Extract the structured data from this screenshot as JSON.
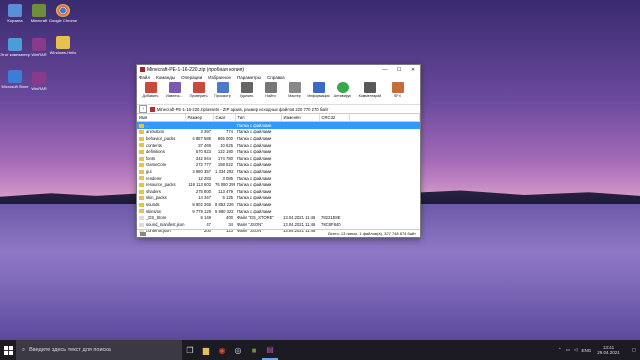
{
  "desktop": {
    "icons": [
      {
        "label": "Корзина",
        "color": "#5a8fd8"
      },
      {
        "label": "Minecraft",
        "color": "#6b8f3a"
      },
      {
        "label": "Google Chrome",
        "color": "#e0e0e0"
      },
      {
        "label": "Этот компьютер",
        "color": "#4a9ed8"
      },
      {
        "label": "WinRAR",
        "color": "#8a3a8a"
      },
      {
        "label": "Windows-Hello",
        "color": "#5a9ad8"
      },
      {
        "label": "Microsoft Store",
        "color": "#3a7ed8"
      },
      {
        "label": "WinRAR",
        "color": "#8a3a8a"
      }
    ]
  },
  "window": {
    "title": "Minecraft-PE-1-16-220.zip (пробная копия)",
    "menu": [
      "Файл",
      "Команды",
      "Операции",
      "Избранное",
      "Параметры",
      "Справка"
    ],
    "toolbar": [
      {
        "label": "Добавить",
        "icon": "add-archive-icon",
        "color": "#c84a3a"
      },
      {
        "label": "Извлечь...",
        "icon": "extract-icon",
        "color": "#7a5ab0"
      },
      {
        "label": "Проверить",
        "icon": "test-icon",
        "color": "#c84a3a"
      },
      {
        "label": "Просмотр",
        "icon": "view-icon",
        "color": "#4a7ac8"
      },
      {
        "label": "Удалить",
        "icon": "delete-icon",
        "color": "#666666"
      },
      {
        "label": "Найти",
        "icon": "find-icon",
        "color": "#777777"
      },
      {
        "label": "Мастер",
        "icon": "wizard-icon",
        "color": "#888888"
      },
      {
        "label": "Информация",
        "icon": "info-icon",
        "color": "#3a6ac8"
      },
      {
        "label": "Антивирус",
        "icon": "antivirus-icon",
        "color": "#3aa84a"
      },
      {
        "label": "Комментарий",
        "icon": "comment-icon",
        "color": "#5a5a5a"
      },
      {
        "label": "SFX",
        "icon": "sfx-icon",
        "color": "#c86a3a"
      }
    ],
    "path": "Minecraft-PE-1-16-220.zip\\assets - ZIP архив, размер исходных файлов 220 770 270 байт",
    "columns": [
      "Имя",
      "Размер",
      "Сжат",
      "Тип",
      "Изменён",
      "CRC32"
    ],
    "rows": [
      {
        "name": "..",
        "size": "",
        "packed": "",
        "type": "Папка с файлами",
        "modified": "",
        "crc": "",
        "selected": true
      },
      {
        "name": "animation",
        "size": "3 397",
        "packed": "774",
        "type": "Папка с файлами",
        "modified": "",
        "crc": "",
        "selected": false
      },
      {
        "name": "behavior_packs",
        "size": "4 887 589",
        "packed": "865 000",
        "type": "Папка с файлами",
        "modified": "",
        "crc": "",
        "selected": false
      },
      {
        "name": "contents",
        "size": "37 469",
        "packed": "10 625",
        "type": "Папка с файлами",
        "modified": "",
        "crc": "",
        "selected": false
      },
      {
        "name": "definitions",
        "size": "570 823",
        "packed": "122 180",
        "type": "Папка с файлами",
        "modified": "",
        "crc": "",
        "selected": false
      },
      {
        "name": "fonts",
        "size": "342 944",
        "packed": "174 780",
        "type": "Папка с файлами",
        "modified": "",
        "crc": "",
        "selected": false
      },
      {
        "name": "GameCore",
        "size": "272 777",
        "packed": "158 522",
        "type": "Папка с файлами",
        "modified": "",
        "crc": "",
        "selected": false
      },
      {
        "name": "gui",
        "size": "3 980 357",
        "packed": "1 334 292",
        "type": "Папка с файлами",
        "modified": "",
        "crc": "",
        "selected": false
      },
      {
        "name": "renderer",
        "size": "12 283",
        "packed": "3 085",
        "type": "Папка с файлами",
        "modified": "",
        "crc": "",
        "selected": false
      },
      {
        "name": "resource_packs",
        "size": "119 113 603",
        "packed": "76 080 299",
        "type": "Папка с файлами",
        "modified": "",
        "crc": "",
        "selected": false
      },
      {
        "name": "shaders",
        "size": "275 800",
        "packed": "113 479",
        "type": "Папка с файлами",
        "modified": "",
        "crc": "",
        "selected": false
      },
      {
        "name": "skin_packs",
        "size": "14 347",
        "packed": "5 135",
        "type": "Папка с файлами",
        "modified": "",
        "crc": "",
        "selected": false
      },
      {
        "name": "sounds",
        "size": "8 902 265",
        "packed": "8 853 226",
        "type": "Папка с файлами",
        "modified": "",
        "crc": "",
        "selected": false
      },
      {
        "name": "skins/on",
        "size": "9 779 129",
        "packed": "5 980 322",
        "type": "Папка с файлами",
        "modified": "",
        "crc": "",
        "selected": false
      },
      {
        "name": "_DS_Store",
        "size": "6 148",
        "packed": "400",
        "type": "Файл \"DS_STORE\"",
        "modified": "13.04.2021 11:46",
        "crc": "78221E8E",
        "selected": false
      },
      {
        "name": "sound_manifest.json",
        "size": "47",
        "packed": "34",
        "type": "Файл \"JSON\"",
        "modified": "13.04.2021 11:46",
        "crc": "78C8F840",
        "selected": false
      },
      {
        "name": "contents.json",
        "size": "200",
        "packed": "123",
        "type": "Файл \"JSON\"",
        "modified": "13.04.2021 11:46",
        "crc": "",
        "selected": false
      }
    ],
    "status_left": "",
    "status_right": "Всего: 13 папок, 1 файлов(а), 327 748 874 байт"
  },
  "taskbar": {
    "search_placeholder": "Введите здесь текст для поиска",
    "tray_lang": "ENG",
    "time": "13:41",
    "date": "29.04.2021"
  }
}
